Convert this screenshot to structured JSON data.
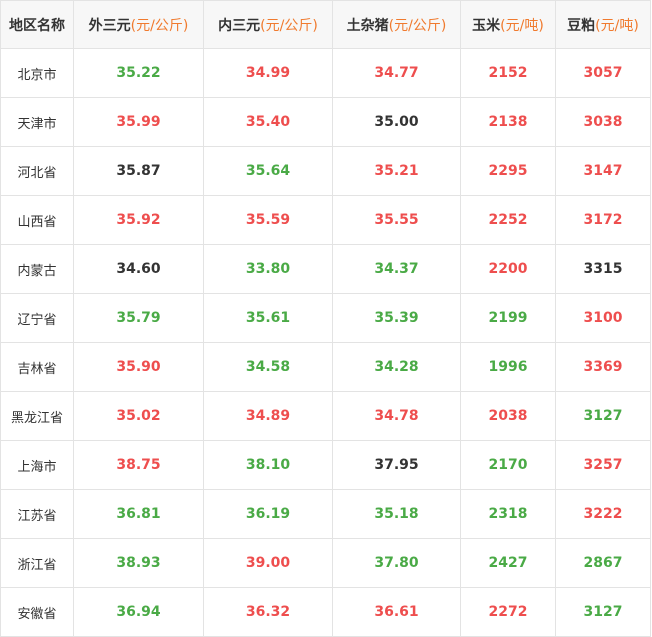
{
  "header": {
    "region": "地区名称",
    "columns": [
      {
        "name": "外三元",
        "unit": "(元/公斤)"
      },
      {
        "name": "内三元",
        "unit": "(元/公斤)"
      },
      {
        "name": "土杂猪",
        "unit": "(元/公斤)"
      },
      {
        "name": "玉米",
        "unit": "(元/吨)"
      },
      {
        "name": "豆粕",
        "unit": "(元/吨)"
      }
    ]
  },
  "colors": {
    "up": "#ee4e4e",
    "down": "#4aaa46",
    "flat": "#333333",
    "unit": "#f07a2e"
  },
  "rows": [
    {
      "region": "北京市",
      "cells": [
        {
          "v": "35.22",
          "t": "down"
        },
        {
          "v": "34.99",
          "t": "up"
        },
        {
          "v": "34.77",
          "t": "up"
        },
        {
          "v": "2152",
          "t": "up"
        },
        {
          "v": "3057",
          "t": "up"
        }
      ]
    },
    {
      "region": "天津市",
      "cells": [
        {
          "v": "35.99",
          "t": "up"
        },
        {
          "v": "35.40",
          "t": "up"
        },
        {
          "v": "35.00",
          "t": "flat"
        },
        {
          "v": "2138",
          "t": "up"
        },
        {
          "v": "3038",
          "t": "up"
        }
      ]
    },
    {
      "region": "河北省",
      "cells": [
        {
          "v": "35.87",
          "t": "flat"
        },
        {
          "v": "35.64",
          "t": "down"
        },
        {
          "v": "35.21",
          "t": "up"
        },
        {
          "v": "2295",
          "t": "up"
        },
        {
          "v": "3147",
          "t": "up"
        }
      ]
    },
    {
      "region": "山西省",
      "cells": [
        {
          "v": "35.92",
          "t": "up"
        },
        {
          "v": "35.59",
          "t": "up"
        },
        {
          "v": "35.55",
          "t": "up"
        },
        {
          "v": "2252",
          "t": "up"
        },
        {
          "v": "3172",
          "t": "up"
        }
      ]
    },
    {
      "region": "内蒙古",
      "cells": [
        {
          "v": "34.60",
          "t": "flat"
        },
        {
          "v": "33.80",
          "t": "down"
        },
        {
          "v": "34.37",
          "t": "down"
        },
        {
          "v": "2200",
          "t": "up"
        },
        {
          "v": "3315",
          "t": "flat"
        }
      ]
    },
    {
      "region": "辽宁省",
      "cells": [
        {
          "v": "35.79",
          "t": "down"
        },
        {
          "v": "35.61",
          "t": "down"
        },
        {
          "v": "35.39",
          "t": "down"
        },
        {
          "v": "2199",
          "t": "down"
        },
        {
          "v": "3100",
          "t": "up"
        }
      ]
    },
    {
      "region": "吉林省",
      "cells": [
        {
          "v": "35.90",
          "t": "up"
        },
        {
          "v": "34.58",
          "t": "down"
        },
        {
          "v": "34.28",
          "t": "down"
        },
        {
          "v": "1996",
          "t": "down"
        },
        {
          "v": "3369",
          "t": "up"
        }
      ]
    },
    {
      "region": "黑龙江省",
      "cells": [
        {
          "v": "35.02",
          "t": "up"
        },
        {
          "v": "34.89",
          "t": "up"
        },
        {
          "v": "34.78",
          "t": "up"
        },
        {
          "v": "2038",
          "t": "up"
        },
        {
          "v": "3127",
          "t": "down"
        }
      ]
    },
    {
      "region": "上海市",
      "cells": [
        {
          "v": "38.75",
          "t": "up"
        },
        {
          "v": "38.10",
          "t": "down"
        },
        {
          "v": "37.95",
          "t": "flat"
        },
        {
          "v": "2170",
          "t": "down"
        },
        {
          "v": "3257",
          "t": "up"
        }
      ]
    },
    {
      "region": "江苏省",
      "cells": [
        {
          "v": "36.81",
          "t": "down"
        },
        {
          "v": "36.19",
          "t": "down"
        },
        {
          "v": "35.18",
          "t": "down"
        },
        {
          "v": "2318",
          "t": "down"
        },
        {
          "v": "3222",
          "t": "up"
        }
      ]
    },
    {
      "region": "浙江省",
      "cells": [
        {
          "v": "38.93",
          "t": "down"
        },
        {
          "v": "39.00",
          "t": "up"
        },
        {
          "v": "37.80",
          "t": "down"
        },
        {
          "v": "2427",
          "t": "down"
        },
        {
          "v": "2867",
          "t": "down"
        }
      ]
    },
    {
      "region": "安徽省",
      "cells": [
        {
          "v": "36.94",
          "t": "down"
        },
        {
          "v": "36.32",
          "t": "up"
        },
        {
          "v": "36.61",
          "t": "up"
        },
        {
          "v": "2272",
          "t": "up"
        },
        {
          "v": "3127",
          "t": "down"
        }
      ]
    }
  ]
}
